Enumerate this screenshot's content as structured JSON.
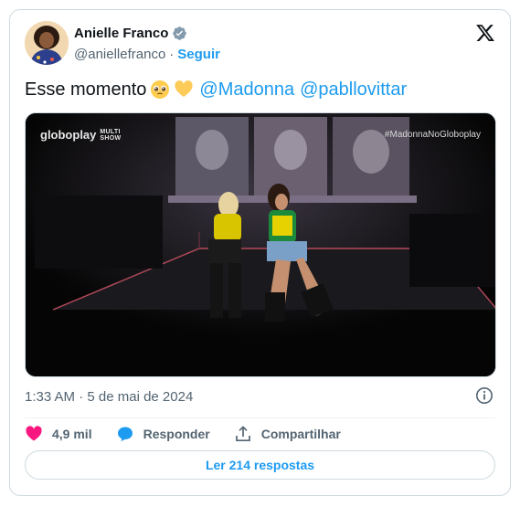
{
  "author": {
    "display_name": "Anielle Franco",
    "handle": "@aniellefranco",
    "separator": "·",
    "follow_label": "Seguir",
    "verified": true
  },
  "tweet": {
    "text": "Esse momento",
    "emojis": [
      "pleading-face-emoji",
      "yellow-heart-emoji"
    ],
    "mentions": [
      "@Madonna",
      "@pabllovittar"
    ]
  },
  "media": {
    "watermark_left": "globoplay",
    "watermark_multi": "MULTI",
    "watermark_show": "SHOW",
    "watermark_right": "#MadonnaNoGloboplay"
  },
  "timestamp": "1:33 AM · 5 de mai de 2024",
  "actions": {
    "like_count": "4,9 mil",
    "reply_label": "Responder",
    "share_label": "Compartilhar"
  },
  "replies_button": "Ler 214 respostas",
  "colors": {
    "accent": "#1d9bf0",
    "like": "#f91880",
    "text": "#0f1419",
    "muted": "#536471"
  },
  "icons": [
    "verified-badge-icon",
    "x-logo-icon",
    "info-icon",
    "heart-icon",
    "reply-bubble-icon",
    "share-icon"
  ]
}
